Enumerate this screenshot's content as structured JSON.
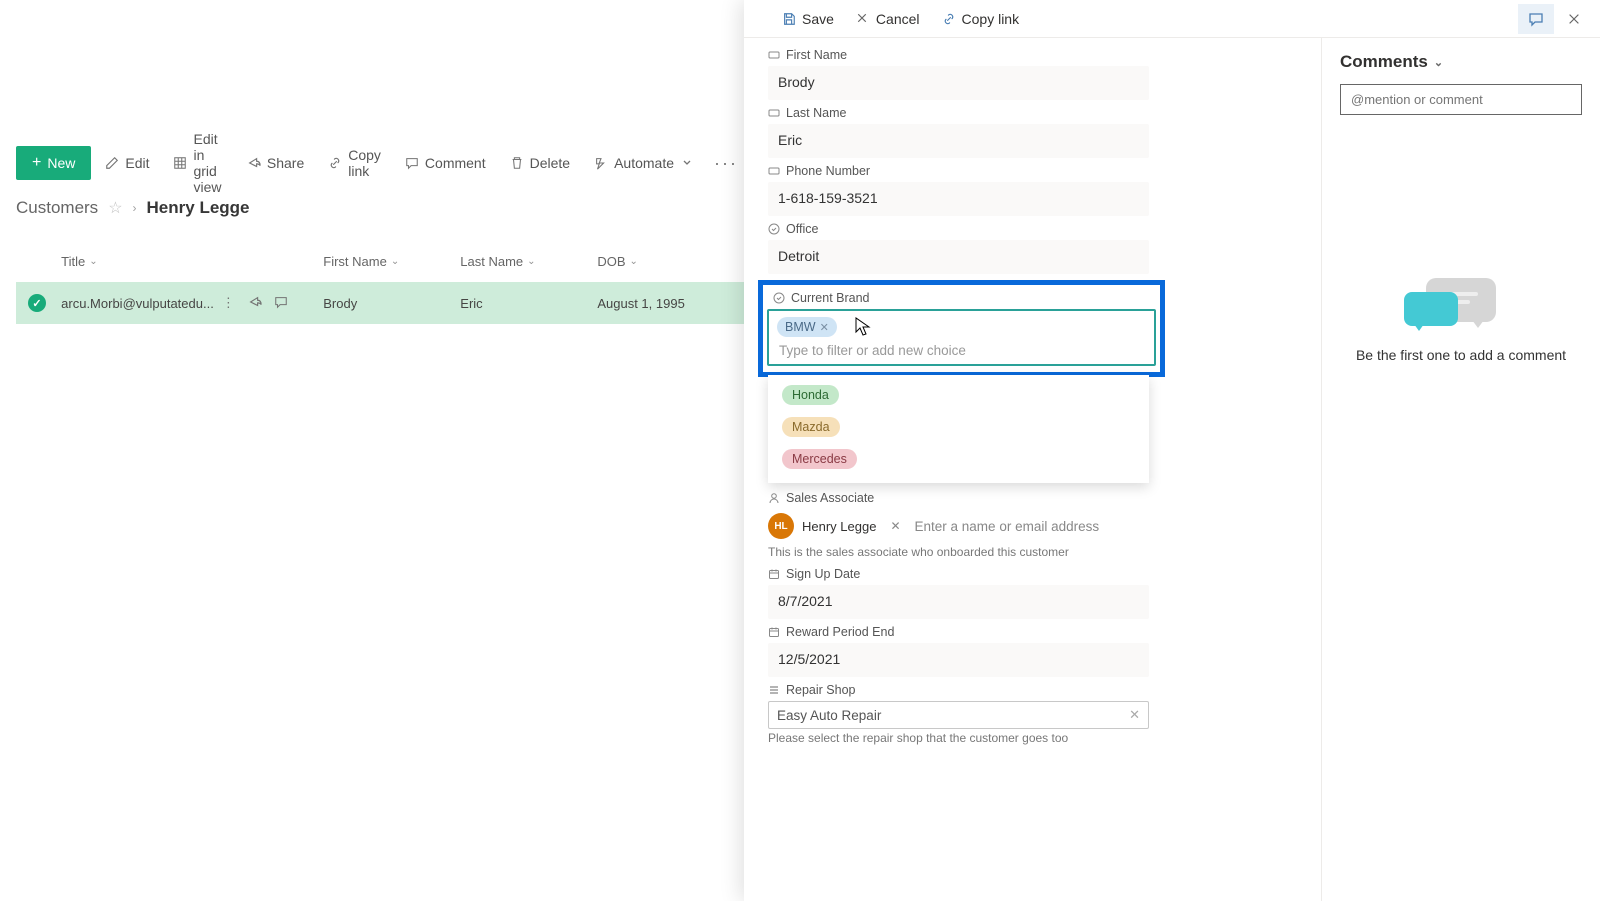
{
  "toolbar": {
    "new": "New",
    "edit": "Edit",
    "edit_grid": "Edit in grid view",
    "share": "Share",
    "copy_link": "Copy link",
    "comment": "Comment",
    "delete": "Delete",
    "automate": "Automate"
  },
  "breadcrumb": {
    "root": "Customers",
    "current": "Henry Legge"
  },
  "table": {
    "headers": {
      "title": "Title",
      "first_name": "First Name",
      "last_name": "Last Name",
      "dob": "DOB"
    },
    "row": {
      "title": "arcu.Morbi@vulputatedu...",
      "first_name": "Brody",
      "last_name": "Eric",
      "dob": "August 1, 1995"
    }
  },
  "panel_actions": {
    "save": "Save",
    "cancel": "Cancel",
    "copy_link": "Copy link"
  },
  "form": {
    "first_name": {
      "label": "First Name",
      "value": "Brody"
    },
    "last_name": {
      "label": "Last Name",
      "value": "Eric"
    },
    "phone": {
      "label": "Phone Number",
      "value": "1-618-159-3521"
    },
    "office": {
      "label": "Office",
      "value": "Detroit"
    },
    "brand": {
      "label": "Current Brand",
      "selected": "BMW",
      "placeholder": "Type to filter or add new choice",
      "options": [
        "Honda",
        "Mazda",
        "Mercedes"
      ]
    },
    "associate": {
      "label": "Sales Associate",
      "initials": "HL",
      "name": "Henry Legge",
      "placeholder": "Enter a name or email address",
      "helper": "This is the sales associate who onboarded this customer"
    },
    "signup": {
      "label": "Sign Up Date",
      "value": "8/7/2021"
    },
    "reward": {
      "label": "Reward Period End",
      "value": "12/5/2021"
    },
    "shop": {
      "label": "Repair Shop",
      "value": "Easy Auto Repair",
      "helper": "Please select the repair shop that the customer goes too"
    }
  },
  "comments": {
    "title": "Comments",
    "placeholder": "@mention or comment",
    "empty": "Be the first one to add a comment"
  }
}
